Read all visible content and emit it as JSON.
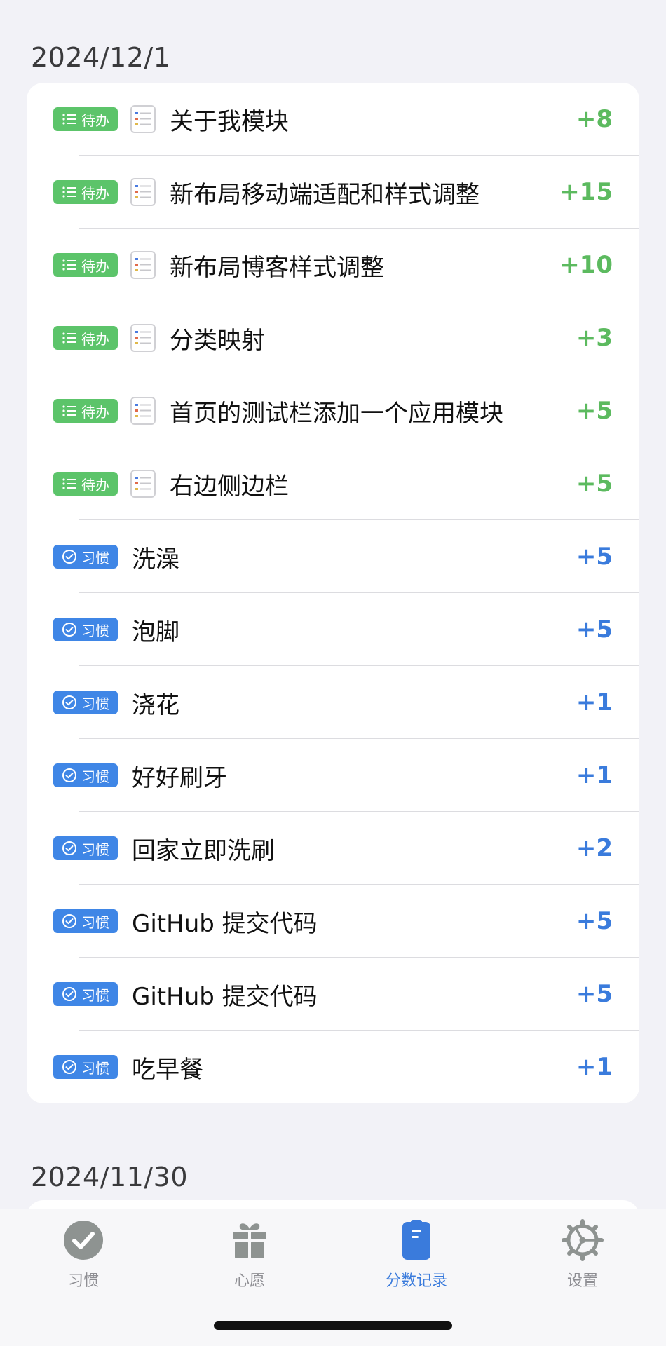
{
  "sections": [
    {
      "date": "2024/12/1",
      "records": [
        {
          "type": "todo",
          "badge": "待办",
          "title": "关于我模块",
          "score": "+8"
        },
        {
          "type": "todo",
          "badge": "待办",
          "title": "新布局移动端适配和样式调整",
          "score": "+15"
        },
        {
          "type": "todo",
          "badge": "待办",
          "title": "新布局博客样式调整",
          "score": "+10"
        },
        {
          "type": "todo",
          "badge": "待办",
          "title": "分类映射",
          "score": "+3"
        },
        {
          "type": "todo",
          "badge": "待办",
          "title": "首页的测试栏添加一个应用模块",
          "score": "+5"
        },
        {
          "type": "todo",
          "badge": "待办",
          "title": "右边侧边栏",
          "score": "+5"
        },
        {
          "type": "habit",
          "badge": "习惯",
          "title": "洗澡",
          "score": "+5"
        },
        {
          "type": "habit",
          "badge": "习惯",
          "title": "泡脚",
          "score": "+5"
        },
        {
          "type": "habit",
          "badge": "习惯",
          "title": "浇花",
          "score": "+1"
        },
        {
          "type": "habit",
          "badge": "习惯",
          "title": "好好刷牙",
          "score": "+1"
        },
        {
          "type": "habit",
          "badge": "习惯",
          "title": "回家立即洗刷",
          "score": "+2"
        },
        {
          "type": "habit",
          "badge": "习惯",
          "title": "GitHub 提交代码",
          "score": "+5"
        },
        {
          "type": "habit",
          "badge": "习惯",
          "title": "GitHub 提交代码",
          "score": "+5"
        },
        {
          "type": "habit",
          "badge": "习惯",
          "title": "吃早餐",
          "score": "+1"
        }
      ]
    },
    {
      "date": "2024/11/30",
      "records": []
    }
  ],
  "tabbar": {
    "tabs": [
      {
        "name": "habits",
        "label": "习惯",
        "icon": "check-circle-icon",
        "active": false
      },
      {
        "name": "wishes",
        "label": "心愿",
        "icon": "gift-icon",
        "active": false
      },
      {
        "name": "score-records",
        "label": "分数记录",
        "icon": "clipboard-icon",
        "active": true
      },
      {
        "name": "settings",
        "label": "设置",
        "icon": "gear-icon",
        "active": false
      }
    ]
  },
  "colors": {
    "todo_green": "#5cc46a",
    "habit_blue": "#3f86e6",
    "active_tab": "#3a7bdc",
    "inactive_tab": "#8e8e93"
  }
}
